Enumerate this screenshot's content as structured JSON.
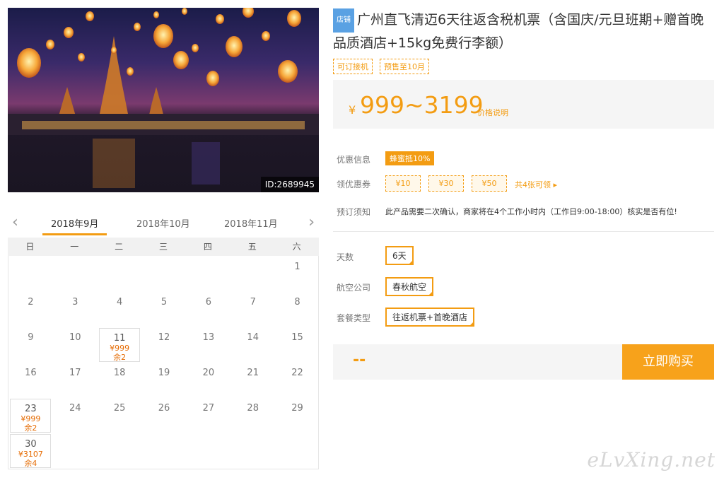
{
  "hero": {
    "id_tag": "ID:2689945"
  },
  "calendar": {
    "prev_icon": "‹",
    "next_icon": "›",
    "months": [
      "2018年9月",
      "2018年10月",
      "2018年11月"
    ],
    "weekdays": [
      "日",
      "一",
      "二",
      "三",
      "四",
      "五",
      "六"
    ],
    "days": [
      {
        "d": "1"
      },
      {
        "d": "2"
      },
      {
        "d": "3"
      },
      {
        "d": "4"
      },
      {
        "d": "5"
      },
      {
        "d": "6"
      },
      {
        "d": "7"
      },
      {
        "d": "8"
      },
      {
        "d": "9"
      },
      {
        "d": "10"
      },
      {
        "d": "11",
        "price": "¥999",
        "left": "余2"
      },
      {
        "d": "12"
      },
      {
        "d": "13"
      },
      {
        "d": "14"
      },
      {
        "d": "15"
      },
      {
        "d": "16"
      },
      {
        "d": "17"
      },
      {
        "d": "18"
      },
      {
        "d": "19"
      },
      {
        "d": "20"
      },
      {
        "d": "21"
      },
      {
        "d": "22"
      },
      {
        "d": "23",
        "price": "¥999",
        "left": "余2"
      },
      {
        "d": "24"
      },
      {
        "d": "25"
      },
      {
        "d": "26"
      },
      {
        "d": "27"
      },
      {
        "d": "28"
      },
      {
        "d": "29"
      },
      {
        "d": "30",
        "price": "¥3107",
        "left": "余4"
      }
    ]
  },
  "product": {
    "shop_tag": "店铺",
    "title": "广州直飞清迈6天往返含税机票（含国庆/元旦班期+赠首晚品质酒店+15kg免费行李额）",
    "tags": [
      "可订接机",
      "预售至10月"
    ],
    "price_yen": "¥",
    "price": "999~3199",
    "price_note": "价格说明",
    "promo_label": "优惠信息",
    "promo": "蜂蜜抵10%",
    "coupon_label": "领优惠券",
    "coupons": [
      "¥10",
      "¥30",
      "¥50"
    ],
    "coupon_more": "共4张可领 ▸",
    "booking_label": "预订须知",
    "booking_note": "此产品需要二次确认，商家将在4个工作小时内（工作日9:00-18:00）核实是否有位!",
    "days_label": "天数",
    "days_value": "6天",
    "airline_label": "航空公司",
    "airline_value": "春秋航空",
    "package_label": "套餐类型",
    "package_value": "往返机票+首晚酒店",
    "total": "--",
    "buy_label": "立即购买"
  },
  "watermark": "eLvXing.net",
  "colors": {
    "accent": "#f39c12",
    "shop_tag": "#5aa1e3",
    "price_bg": "#f5f5f5"
  }
}
